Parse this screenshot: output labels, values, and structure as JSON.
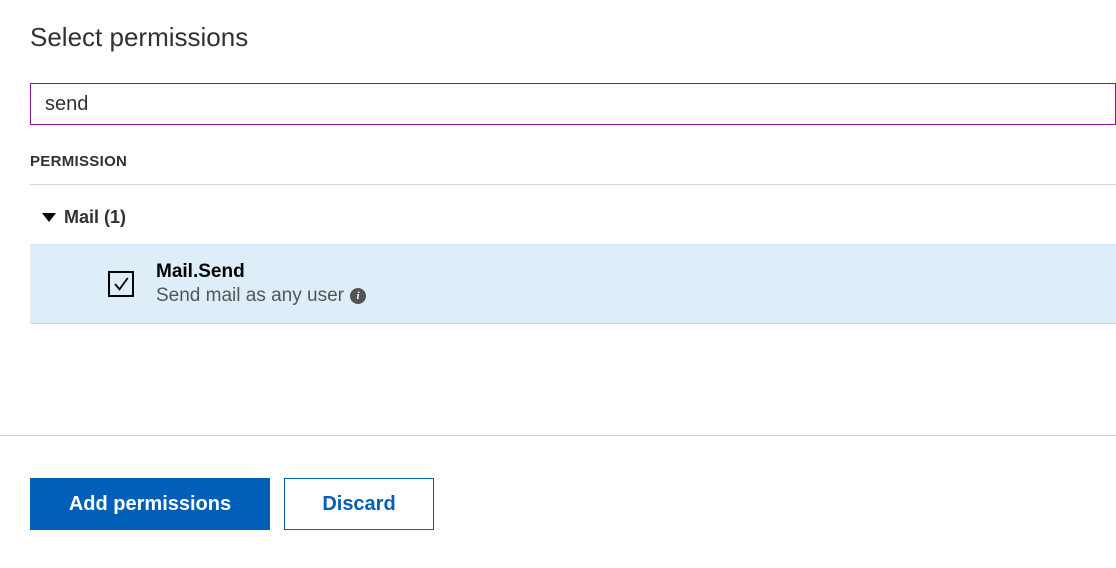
{
  "header": {
    "title": "Select permissions"
  },
  "search": {
    "value": "send"
  },
  "table": {
    "column_header": "PERMISSION"
  },
  "group": {
    "label": "Mail (1)"
  },
  "permission": {
    "name": "Mail.Send",
    "description": "Send mail as any user",
    "checked": true
  },
  "footer": {
    "primary_label": "Add permissions",
    "secondary_label": "Discard"
  }
}
